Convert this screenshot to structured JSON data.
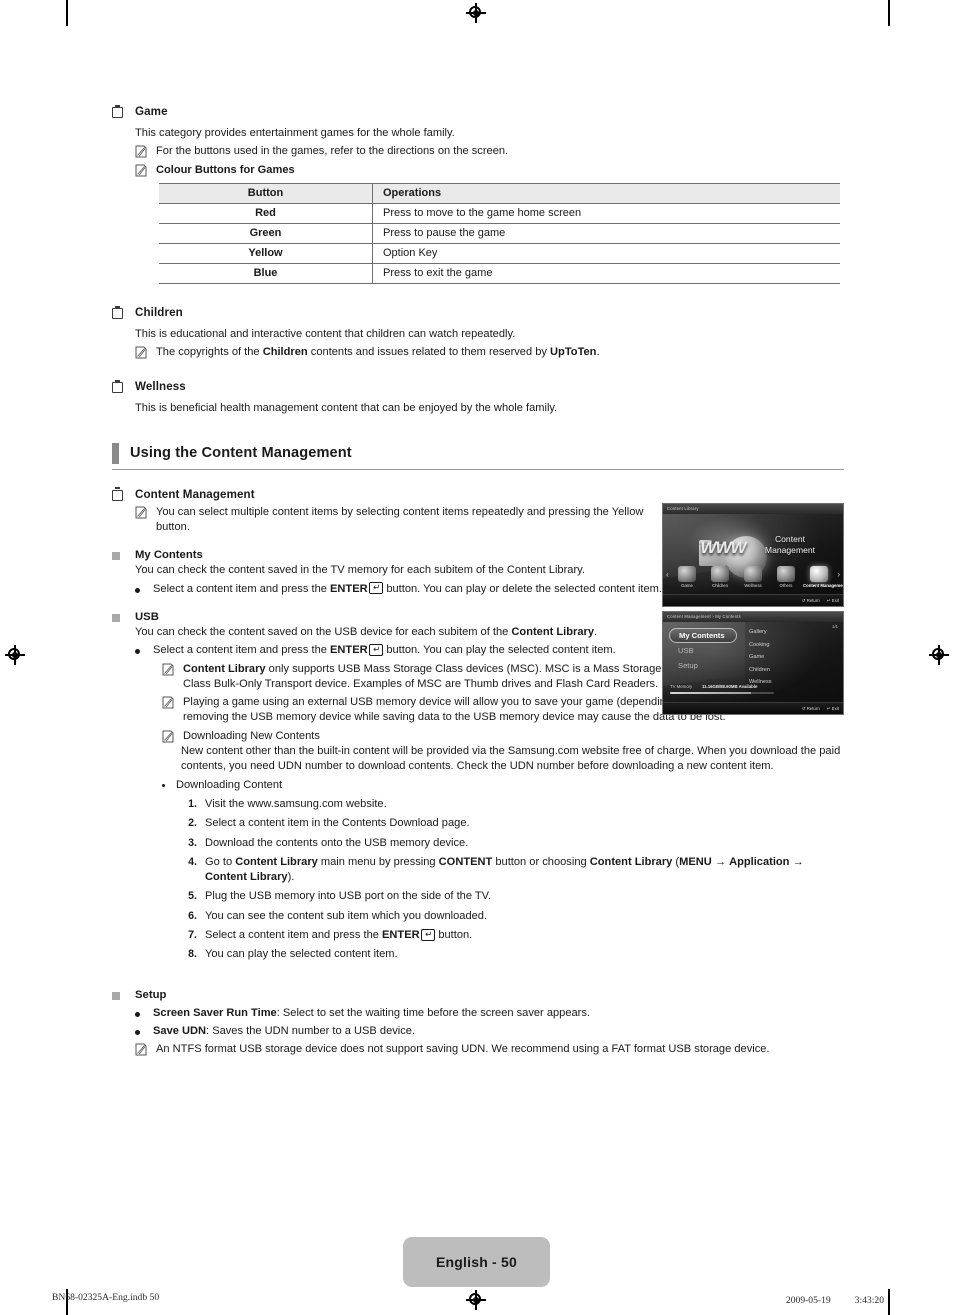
{
  "page": {
    "number_label": "English - 50",
    "footer_left": "BN68-02325A-Eng.indb   50",
    "footer_right": "2009-05-19   　　 3:43:20"
  },
  "sections": {
    "game": {
      "heading": "Game",
      "intro": "This category provides entertainment games for the whole family.",
      "note1": "For the buttons used in the games, refer to the directions on the screen.",
      "note2": "Colour Buttons for Games",
      "table": {
        "headers": [
          "Button",
          "Operations"
        ],
        "rows": [
          [
            "Red",
            "Press to move to the game home screen"
          ],
          [
            "Green",
            "Press to pause the game"
          ],
          [
            "Yellow",
            "Option Key"
          ],
          [
            "Blue",
            "Press to exit the game"
          ]
        ]
      }
    },
    "children": {
      "heading": "Children",
      "intro": "This is educational and interactive content that children can watch repeatedly.",
      "note": "The copyrights of the Children contents and issues related to them reserved by UpToTen."
    },
    "wellness": {
      "heading": "Wellness",
      "intro": "This is beneficial health management content that can be enjoyed by the whole family."
    },
    "banner": {
      "title": "Using the Content Management"
    },
    "content_management": {
      "heading": "Content Management",
      "note": "You can select multiple content items by selecting content items repeatedly and pressing the Yellow button."
    },
    "my_contents": {
      "heading": "My Contents",
      "intro": "You can check the content saved in the TV memory for each subitem of the Content Library.",
      "bullet": "Select a content item and press the ENTER button. You can play or delete the selected content item."
    },
    "usb": {
      "heading": "USB",
      "intro": "You can check the content saved on the USB device for each subitem of the Content Library.",
      "bullet": "Select a content item and press the ENTER button. You can play the selected content item.",
      "note1": "Content Library only supports USB Mass Storage Class devices (MSC). MSC is a Mass Storage Class Bulk-Only Transport device. Examples of MSC are Thumb drives and Flash Card Readers.",
      "note2": "Playing a game using an external USB memory device will allow you to save your game (depending on the game). Take care as removing the USB memory device while saving data to the USB memory device may cause the data to be lost.",
      "note3_title": "Downloading New Contents",
      "note3_body": "New content other than the built-in content will be provided via the Samsung.com website free of charge. When you download the paid contents, you need UDN number to download contents. Check the UDN number before downloading a new content item.",
      "downloading_content_label": "Downloading Content",
      "steps": [
        "Visit the www.samsung.com website.",
        "Select a content item in the Contents Download page.",
        "Download the contents onto the USB memory device.",
        "Go to Content Library main menu by pressing CONTENT button or choosing Content Library (MENU → Application → Content Library).",
        "Plug the USB memory into USB port on the side of the TV.",
        "You can see the content sub item which you downloaded.",
        "Select a content item and press the ENTER button.",
        "You can play the selected content item."
      ],
      "step_numbers": [
        "1.",
        "2.",
        "3.",
        "4.",
        "5.",
        "6.",
        "7.",
        "8."
      ]
    },
    "setup": {
      "heading": "Setup",
      "bullet1_bold": "Screen Saver Run Time",
      "bullet1_rest": ": Select to set the waiting time before the screen saver appears.",
      "bullet2_bold": "Save UDN",
      "bullet2_rest": ": Saves the UDN number to a USB device.",
      "note": "An NTFS format USB storage device does not support saving UDN. We recommend using a FAT format USB storage device."
    }
  },
  "screenshots": {
    "content_library": {
      "titlebar": "Content Library",
      "main_label_line1": "Content",
      "main_label_line2": "Management",
      "logo_text": "WWW",
      "items": [
        {
          "label": "Game",
          "selected": false
        },
        {
          "label": "Children",
          "selected": false
        },
        {
          "label": "Wellness",
          "selected": false
        },
        {
          "label": "Others",
          "selected": false
        },
        {
          "label": "Content Management",
          "selected": true
        }
      ],
      "foot_return": "↺ Return",
      "foot_exit": "↵ Exit",
      "arrow_left": "‹",
      "arrow_right": "›"
    },
    "content_management": {
      "titlebar": "Content Management › My Contents",
      "page_indicator": "1/1",
      "menu": [
        {
          "label": "My Contents",
          "selected": true
        },
        {
          "label": "USB",
          "selected": false
        },
        {
          "label": "Setup",
          "selected": false
        }
      ],
      "sub_items": [
        "Gallery",
        "Cooking",
        "Game",
        "Children",
        "Wellness"
      ],
      "memory_label": "TV Memory",
      "memory_value": "11.16GB/88.60MB Available",
      "foot_return": "↺ Return",
      "foot_exit": "↵ Exit"
    }
  },
  "colors": {
    "banner_bar": "#8a8a8a",
    "table_header_bg": "#eaeaea",
    "page_badge_bg": "#bdbdbd",
    "sub_bullet": "#a8a8a8"
  }
}
